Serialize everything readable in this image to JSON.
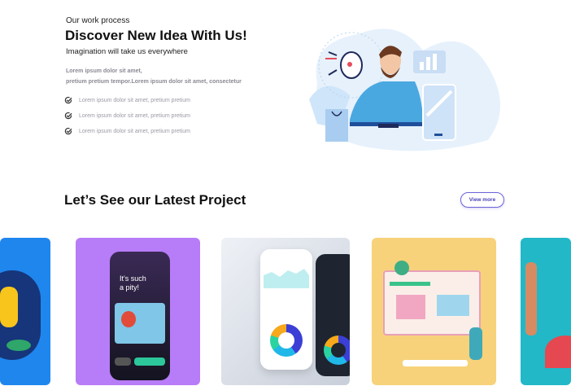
{
  "hero": {
    "eyebrow": "Our work process",
    "title": "Discover New Idea With Us!",
    "subtitle": "Imagination will take us everywhere",
    "description_line1": "Lorem ipsum dolor sit amet,",
    "description_line2": "pretium pretium tempor.Lorem ipsum dolor sit amet, consectetur",
    "checklist": [
      "Lorem ipsum dolor sit amet, pretium pretium",
      "Lorem ipsum dolor sit amet, pretium pretium",
      "Lorem ipsum dolor sit amet, pretium pretium"
    ]
  },
  "projects": {
    "title": "Let’s See our Latest Project",
    "view_more": "View more",
    "card_phone": {
      "headline": "It's such a pity!"
    }
  },
  "colors": {
    "accent": "#6b63d8",
    "purple": "#b77cf7",
    "blue": "#1f86ee",
    "yellow": "#f7d27a",
    "teal": "#22b8c8"
  }
}
